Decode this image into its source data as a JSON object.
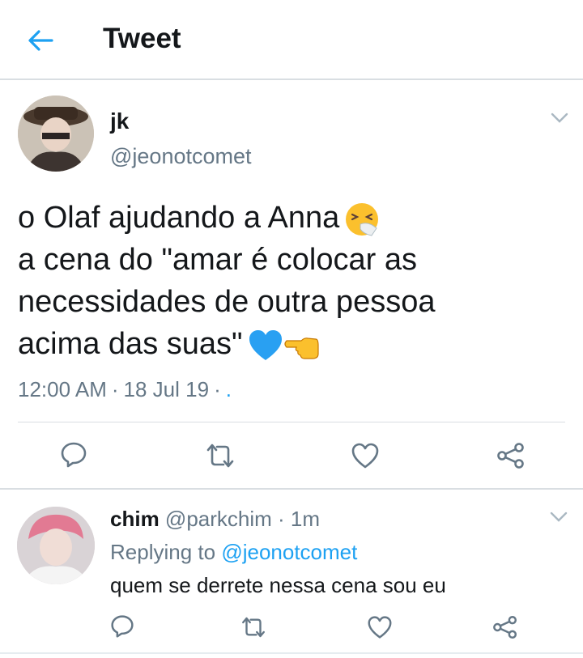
{
  "header": {
    "title": "Tweet",
    "back_icon": "back-arrow-icon",
    "accent": "#1da1f2"
  },
  "tweet": {
    "name": "jk",
    "handle": "@jeonotcomet",
    "lines": [
      "o Olaf ajudando a Anna",
      "a cena do \"amar é colocar as",
      "necessidades de outra pessoa",
      "acima das suas\""
    ],
    "emojis": [
      "sneezing-face-emoji",
      "blue-heart-emoji",
      "backhand-index-pointing-left-emoji"
    ],
    "time": "12:00 AM",
    "date": "18 Jul 19",
    "sep": "·",
    "source": "."
  },
  "reply": {
    "name": "chim",
    "handle": "@parkchim",
    "age": "· 1m",
    "replying_prefix": "Replying to",
    "replying_to": "@jeonotcomet",
    "text": "quem se derrete nessa cena sou eu"
  },
  "actions": [
    "reply-icon",
    "retweet-icon",
    "like-icon",
    "share-icon"
  ],
  "colors": {
    "text": "#14171a",
    "secondary": "#657786",
    "divider": "#d9dee2",
    "link": "#1da1f2"
  }
}
